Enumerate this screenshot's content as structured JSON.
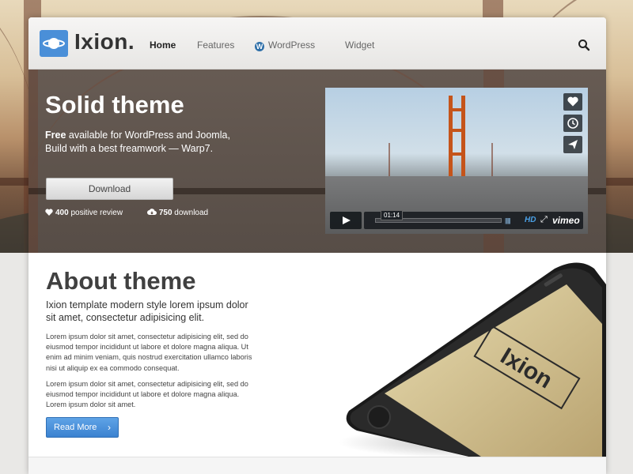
{
  "header": {
    "logo_text": "Ixion.",
    "nav": [
      {
        "label": "Home",
        "active": true
      },
      {
        "label": "Features",
        "active": false
      },
      {
        "label": "WordPress",
        "active": false,
        "icon": "wordpress-icon"
      },
      {
        "label": "Widget",
        "active": false
      }
    ],
    "search_icon": "search-icon"
  },
  "hero": {
    "title": "Solid theme",
    "subtitle_bold": "Free",
    "subtitle_rest": " available for WordPress and Joomla,",
    "subtitle_line2": "Build with a best freamwork — Warp7.",
    "download_label": "Download",
    "reviews_count": "400",
    "reviews_label": " positive review",
    "downloads_count": "750",
    "downloads_label": " download"
  },
  "video": {
    "time": "01:14",
    "progress": 0.0,
    "hd_label": "HD",
    "brand_label": "vimeo",
    "side_icons": [
      "heart-icon",
      "clock-icon",
      "send-icon"
    ]
  },
  "about": {
    "title": "About theme",
    "lead": "Ixion template modern style lorem ipsum dolor sit amet, consectetur adipisicing elit.",
    "paragraph1": "Lorem ipsum dolor sit amet, consectetur adipisicing elit, sed do eiusmod tempor incididunt ut labore et dolore magna aliqua. Ut enim ad minim veniam, quis nostrud exercitation ullamco laboris nisi ut aliquip ex ea commodo consequat.",
    "paragraph2": "Lorem ipsum dolor sit amet, consectetur adipisicing elit, sed do eiusmod tempor incididunt ut labore et dolore magna aliqua. Lorem ipsum dolor sit amet.",
    "readmore_label": "Read More",
    "phone_screen_text": "Ixion"
  },
  "colors": {
    "accent": "#3b82d0",
    "logo_bg": "#4a8fd8",
    "bridge_orange": "#c5541a"
  }
}
